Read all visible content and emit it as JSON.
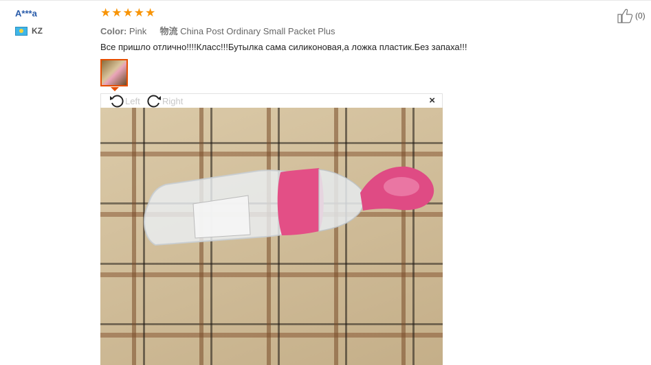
{
  "review": {
    "user_name": "A***a",
    "country_code": "KZ",
    "rating": 5,
    "color_label": "Color:",
    "color_value": "Pink",
    "shipping_label": "物流",
    "shipping_value": "China Post Ordinary Small Packet Plus",
    "text": "Все пришло отлично!!!!Класс!!!Бутылка сама силиконовая,а ложка пластик.Без запаха!!!",
    "helpful_count": "(0)"
  },
  "viewer": {
    "rotate_left_label": "Left",
    "rotate_right_label": "Right",
    "close_symbol": "×"
  },
  "icons": {
    "star": "star-icon",
    "helpful": "thumbs-up-icon",
    "flag": "kz-flag-icon",
    "rotate_left": "rotate-left-icon",
    "rotate_right": "rotate-right-icon",
    "close": "close-icon"
  },
  "colors": {
    "star": "#f89406",
    "user_name": "#2a5caa",
    "thumb_border": "#e64d00"
  }
}
